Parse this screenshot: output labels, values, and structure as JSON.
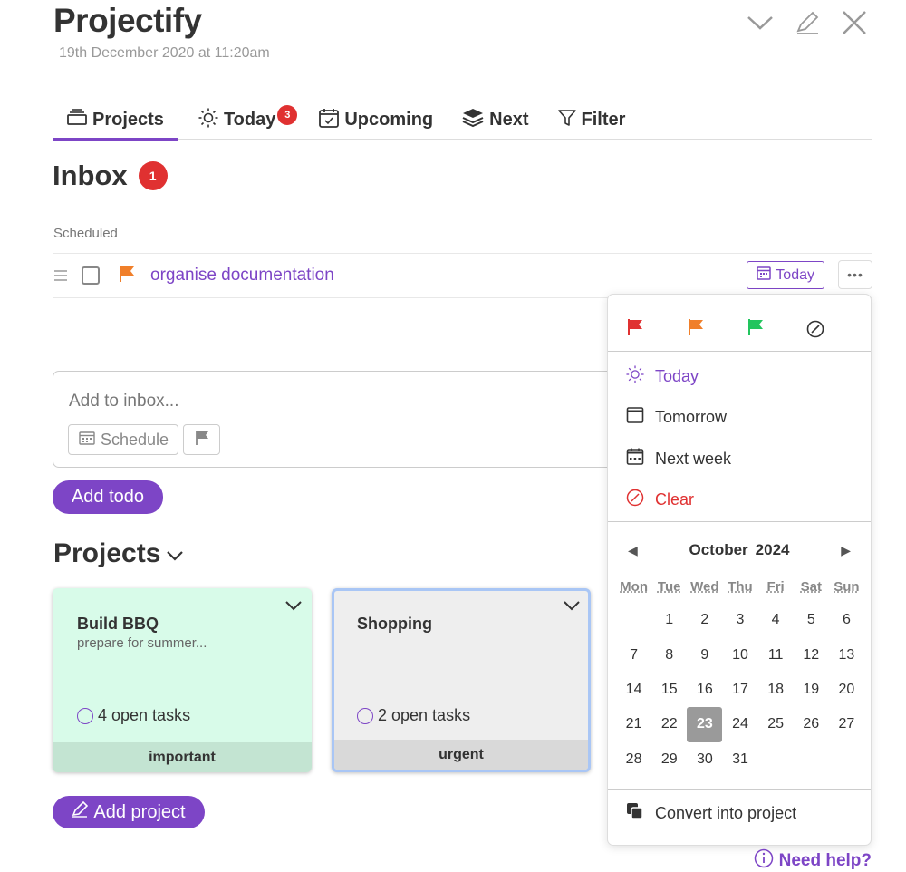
{
  "header": {
    "title": "Projectify",
    "subtitle": "19th December 2020 at 11:20am"
  },
  "tabs": [
    {
      "label": "Projects",
      "icon": "projects-icon",
      "active": true
    },
    {
      "label": "Today",
      "icon": "sun-icon",
      "badge": "3"
    },
    {
      "label": "Upcoming",
      "icon": "calendar-icon"
    },
    {
      "label": "Next",
      "icon": "layers-icon"
    },
    {
      "label": "Filter",
      "icon": "filter-icon"
    }
  ],
  "inbox": {
    "title": "Inbox",
    "badge": "1",
    "section": "Scheduled",
    "todo": {
      "text": "organise documentation",
      "due_label": "Today",
      "flag_color": "#f07f2a"
    },
    "add_placeholder": "Add to inbox...",
    "schedule_label": "Schedule",
    "add_button": "Add todo"
  },
  "projects": {
    "title": "Projects",
    "cards": [
      {
        "name": "Build BBQ",
        "description": "prepare for summer...",
        "open_tasks": "4 open tasks",
        "tag": "important"
      },
      {
        "name": "Shopping",
        "description": "",
        "open_tasks": "2 open tasks",
        "tag": "urgent"
      }
    ],
    "add_button": "Add project"
  },
  "dropdown": {
    "flag_colors": [
      "#e03131",
      "#f07f2a",
      "#22c55e"
    ],
    "quick": [
      {
        "label": "Today",
        "icon": "sun-icon",
        "color": "#7d45c6"
      },
      {
        "label": "Tomorrow",
        "icon": "calendar-tomorrow-icon"
      },
      {
        "label": "Next week",
        "icon": "calendar-week-icon"
      },
      {
        "label": "Clear",
        "icon": "clear-icon",
        "color": "#e03131"
      }
    ],
    "calendar": {
      "month": "October",
      "year": "2024",
      "weekdays": [
        "Mon",
        "Tue",
        "Wed",
        "Thu",
        "Fri",
        "Sat",
        "Sun"
      ],
      "selected_day": "23",
      "first_weekday_offset": 1,
      "days_in_month": 31
    },
    "convert_label": "Convert into project"
  },
  "help": "Need help?",
  "colors": {
    "accent": "#7d45c6",
    "badge": "#e03131"
  }
}
